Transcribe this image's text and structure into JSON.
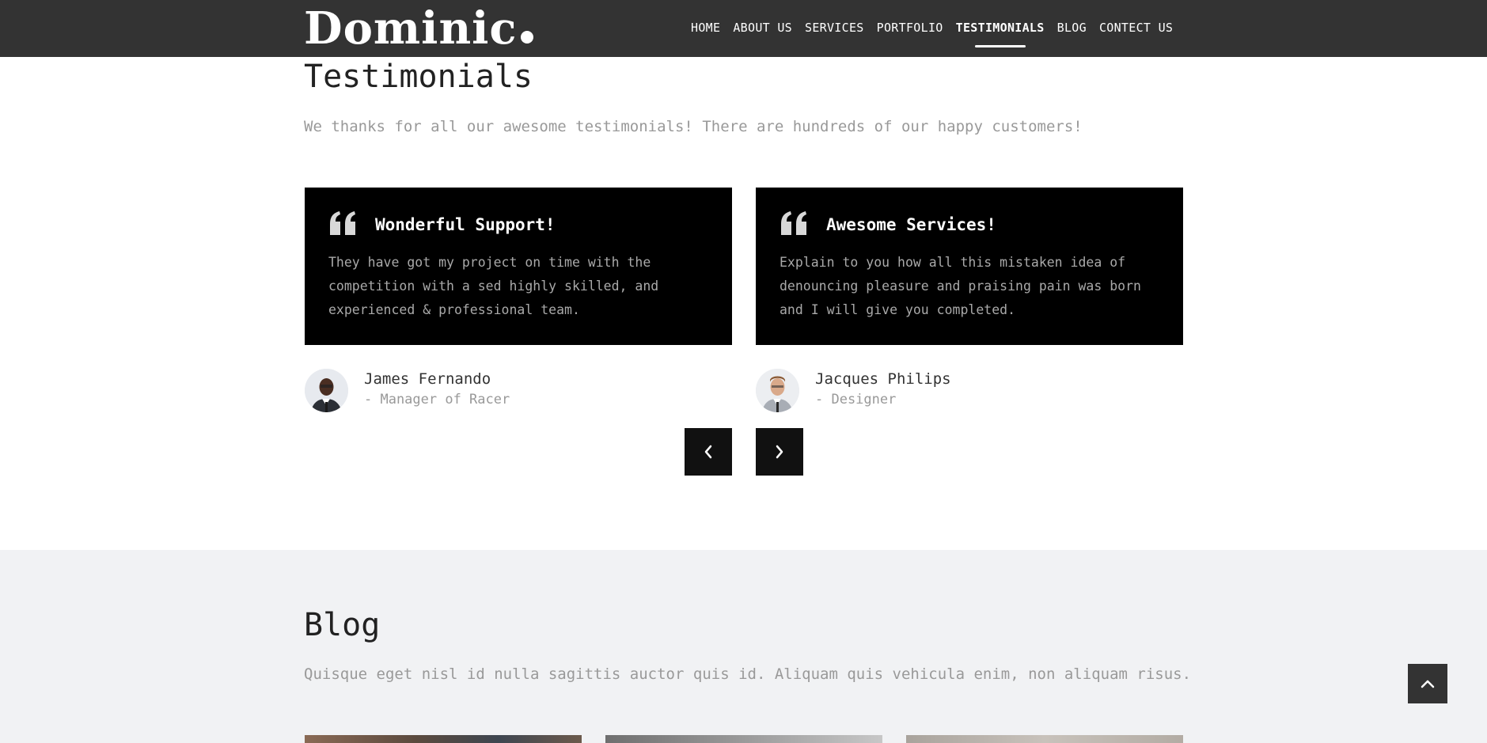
{
  "header": {
    "logo": "Dominic",
    "nav": [
      {
        "label": "HOME",
        "active": false
      },
      {
        "label": "ABOUT US",
        "active": false
      },
      {
        "label": "SERVICES",
        "active": false
      },
      {
        "label": "PORTFOLIO",
        "active": false
      },
      {
        "label": "TESTIMONIALS",
        "active": true
      },
      {
        "label": "BLOG",
        "active": false
      },
      {
        "label": "CONTECT US",
        "active": false
      }
    ]
  },
  "testimonials": {
    "title": "Testimonials",
    "subtitle": "We thanks for all our awesome testimonials! There are hundreds of our happy customers!",
    "items": [
      {
        "heading": "Wonderful Support!",
        "text": "They have got my project on time with the competition with a sed highly skilled, and experienced & professional team.",
        "name": "James Fernando",
        "role": "- Manager of Racer"
      },
      {
        "heading": "Awesome Services!",
        "text": "Explain to you how all this mistaken idea of denouncing pleasure and praising pain was born and I will give you completed.",
        "name": "Jacques Philips",
        "role": "- Designer"
      }
    ],
    "prev_icon": "chevron-left-icon",
    "next_icon": "chevron-right-icon"
  },
  "blog": {
    "title": "Blog",
    "subtitle": "Quisque eget nisl id nulla sagittis auctor quis id. Aliquam quis vehicula enim, non aliquam risus."
  },
  "scroll_top_icon": "chevron-up-icon",
  "colors": {
    "header_bg": "#333333",
    "card_bg": "#000000",
    "blog_bg": "#f1f2f4"
  }
}
